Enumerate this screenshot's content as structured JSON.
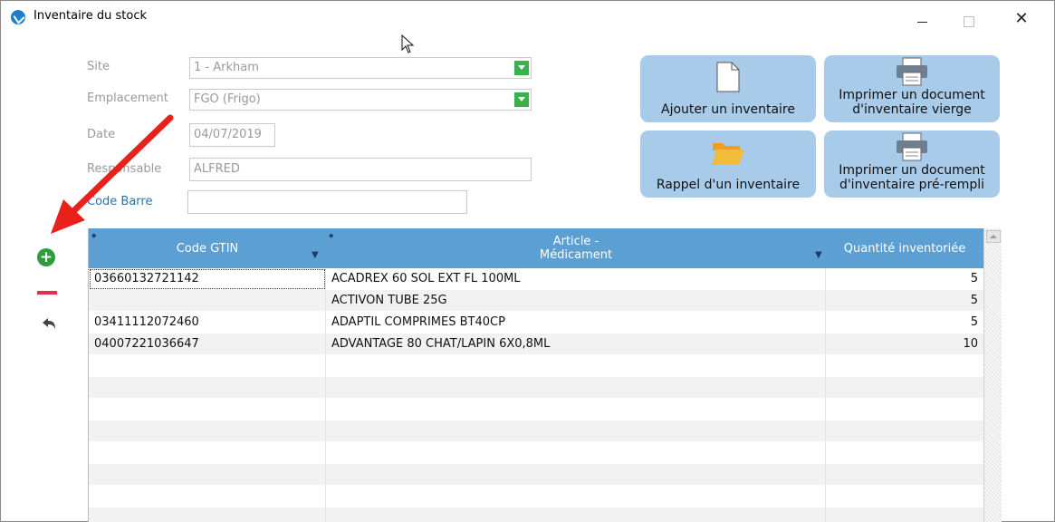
{
  "window": {
    "title": "Inventaire du stock",
    "controls": {
      "minimize": "—",
      "maximize": "☐",
      "close": "✕"
    }
  },
  "form": {
    "site": {
      "label": "Site",
      "value": "1 - Arkham"
    },
    "emplacement": {
      "label": "Emplacement",
      "value": "FGO (Frigo)"
    },
    "date": {
      "label": "Date",
      "value": "04/07/2019"
    },
    "responsable": {
      "label": "Responsable",
      "value": "ALFRED"
    },
    "code_barre": {
      "label": "Code Barre",
      "value": ""
    }
  },
  "actions": {
    "ajouter": "Ajouter un inventaire",
    "imprimer_vierge": "Imprimer un document d'inventaire vierge",
    "rappel": "Rappel d'un inventaire",
    "imprimer_prerempli": "Imprimer un document d'inventaire pré-rempli"
  },
  "tools": {
    "add": "+",
    "undo": "➥"
  },
  "grid": {
    "headers": {
      "code_gtin": "Code GTIN",
      "article": "Article -\nMédicament",
      "quantite": "Quantité inventoriée"
    },
    "rows": [
      {
        "gtin": "03660132721142",
        "article": "ACADREX 60 SOL EXT FL 100ML",
        "qty": "5"
      },
      {
        "gtin": "",
        "article": "ACTIVON TUBE 25G",
        "qty": "5"
      },
      {
        "gtin": "03411112072460",
        "article": "ADAPTIL COMPRIMES BT40CP",
        "qty": "5"
      },
      {
        "gtin": "04007221036647",
        "article": "ADVANTAGE 80 CHAT/LAPIN 6X0,8ML",
        "qty": "10"
      },
      {
        "gtin": "",
        "article": "",
        "qty": ""
      },
      {
        "gtin": "",
        "article": "",
        "qty": ""
      },
      {
        "gtin": "",
        "article": "",
        "qty": ""
      },
      {
        "gtin": "",
        "article": "",
        "qty": ""
      },
      {
        "gtin": "",
        "article": "",
        "qty": ""
      },
      {
        "gtin": "",
        "article": "",
        "qty": ""
      },
      {
        "gtin": "",
        "article": "",
        "qty": ""
      },
      {
        "gtin": "",
        "article": "",
        "qty": ""
      }
    ]
  },
  "colors": {
    "header": "#5b9fd3",
    "action_button": "#a7cbe9",
    "accent_green": "#37b24d",
    "arrow": "#e8211a"
  }
}
